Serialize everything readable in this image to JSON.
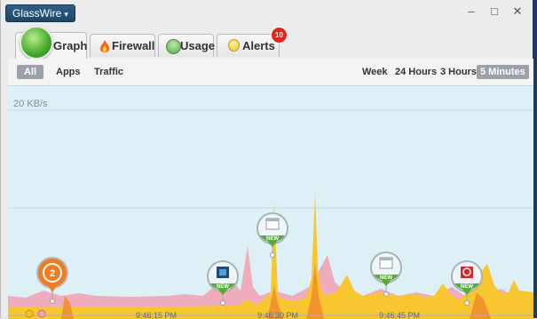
{
  "app": {
    "menu_label": "GlassWire",
    "menu_caret": "▾"
  },
  "window_controls": {
    "minimize": "–",
    "maximize": "□",
    "close": "✕"
  },
  "tabs": [
    {
      "label": "Graph",
      "icon": "globe-icon"
    },
    {
      "label": "Firewall",
      "icon": "flame-icon"
    },
    {
      "label": "Usage",
      "icon": "usage-icon"
    },
    {
      "label": "Alerts",
      "icon": "bulb-icon",
      "badge": "10"
    }
  ],
  "filters": [
    "All",
    "Apps",
    "Traffic"
  ],
  "ranges": [
    "Week",
    "24 Hours",
    "3 Hours",
    "5 Minutes"
  ],
  "active_range": "5 Minutes",
  "graph": {
    "scale_label": "20 KB/s",
    "times": [
      "9:46:15 PM",
      "9:46:30 PM",
      "9:46:45 PM"
    ],
    "markers": [
      {
        "type": "count",
        "text": "2",
        "color": "#f07c22"
      },
      {
        "type": "app",
        "text": "NEW",
        "color": "#5aaa3a"
      },
      {
        "type": "app",
        "text": "NEW",
        "color": "#5aaa3a"
      },
      {
        "type": "app",
        "text": "NEW",
        "color": "#5aaa3a"
      },
      {
        "type": "app",
        "text": "NEW",
        "color": "#5aaa3a"
      }
    ]
  },
  "colors": {
    "upload": "#f0a8b8",
    "download": "#f7c52a",
    "hot": "#f07a2a",
    "accent": "#2c5c84"
  }
}
